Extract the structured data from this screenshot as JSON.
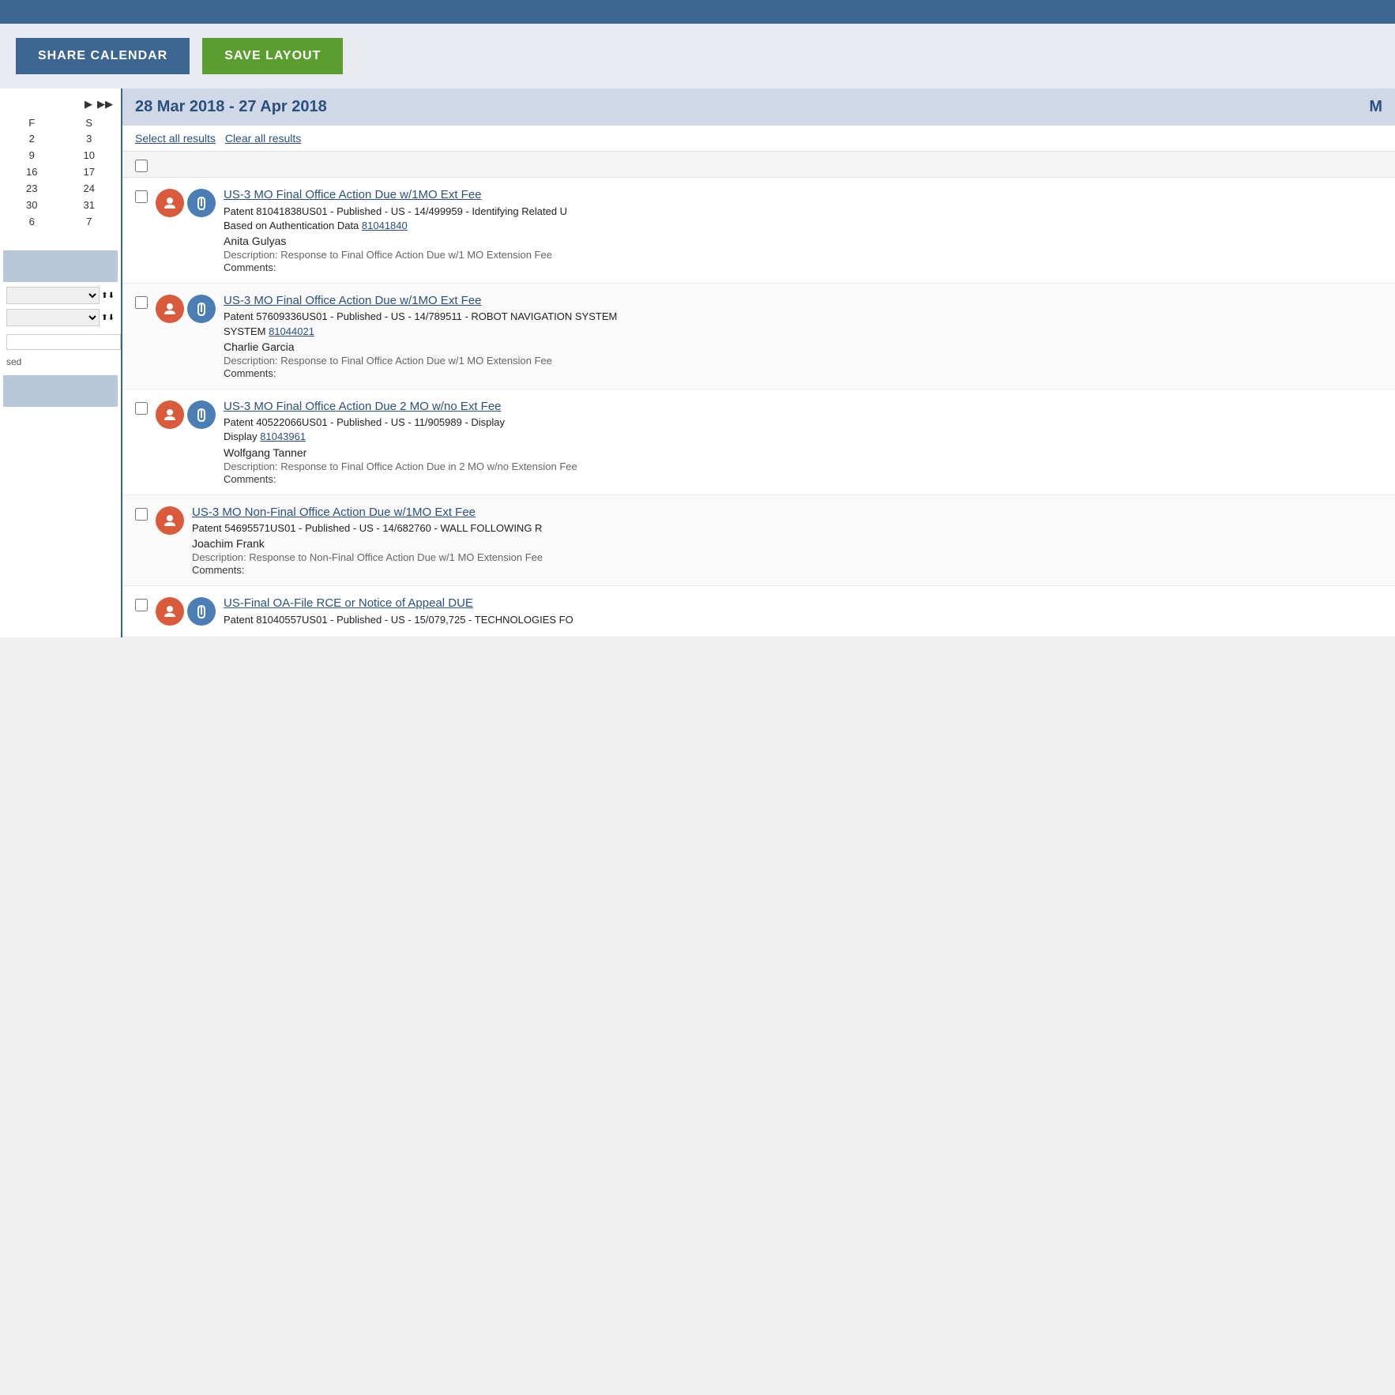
{
  "topbar": {},
  "toolbar": {
    "share_label": "SHARE CALENDAR",
    "save_label": "SAVE LAYOUT"
  },
  "sidebar": {
    "nav_forward": "▶",
    "nav_fast_forward": "▶▶",
    "calendar": {
      "headers": [
        "F",
        "S"
      ],
      "rows": [
        [
          "2",
          "3"
        ],
        [
          "9",
          "10"
        ],
        [
          "16",
          "17"
        ],
        [
          "23",
          "24"
        ],
        [
          "30",
          "31"
        ],
        [
          "6",
          "7"
        ]
      ]
    },
    "label_closed": "sed"
  },
  "main": {
    "date_range": "28 Mar 2018 - 27 Apr 2018",
    "date_range_right": "M",
    "select_all": "Select all results",
    "clear_all": "Clear all results",
    "events": [
      {
        "id": 1,
        "title": "US-3 MO Final Office Action Due w/1MO Ext Fee",
        "patent": "Patent 81041838US01 - Published - US - 14/499959 - Identifying Related U",
        "patent_link": "81041840",
        "patent_link_prefix": "Based on Authentication Data ",
        "assignee": "Anita Gulyas",
        "description": "Response to Final Office Action Due w/1 MO Extension Fee",
        "comments": "",
        "has_attachment": true,
        "icon_type": "both"
      },
      {
        "id": 2,
        "title": "US-3 MO Final Office Action Due w/1MO Ext Fee",
        "patent": "Patent 57609336US01 - Published - US - 14/789511 - ROBOT NAVIGATION SYSTEM ",
        "patent_link": "81044021",
        "patent_link_prefix": "SYSTEM ",
        "assignee": "Charlie Garcia",
        "description": "Response to Final Office Action Due w/1 MO Extension Fee",
        "comments": "",
        "has_attachment": true,
        "icon_type": "both"
      },
      {
        "id": 3,
        "title": "US-3 MO Final Office Action Due 2 MO w/no Ext Fee",
        "patent": "Patent 40522066US01 - Published - US - 11/905989 - Display ",
        "patent_link": "81043961",
        "patent_link_prefix": "Display ",
        "assignee": "Wolfgang Tanner",
        "description": "Response to Final Office Action Due in 2 MO w/no Extension Fee",
        "comments": "",
        "has_attachment": true,
        "icon_type": "both"
      },
      {
        "id": 4,
        "title": "US-3 MO Non-Final Office Action Due w/1MO Ext Fee",
        "patent": "Patent 54695571US01 - Published - US - 14/682760 - WALL FOLLOWING R",
        "patent_link": "",
        "patent_link_prefix": "",
        "assignee": "Joachim Frank",
        "description": "Response to Non-Final Office Action Due w/1 MO Extension Fee",
        "comments": "",
        "has_attachment": false,
        "icon_type": "single"
      },
      {
        "id": 5,
        "title": "US-Final OA-File RCE or Notice of Appeal DUE",
        "patent": "Patent 81040557US01 - Published - US - 15/079,725 - TECHNOLOGIES FO",
        "patent_link": "",
        "patent_link_prefix": "",
        "assignee": "",
        "description": "",
        "comments": "",
        "has_attachment": true,
        "icon_type": "both"
      }
    ]
  }
}
